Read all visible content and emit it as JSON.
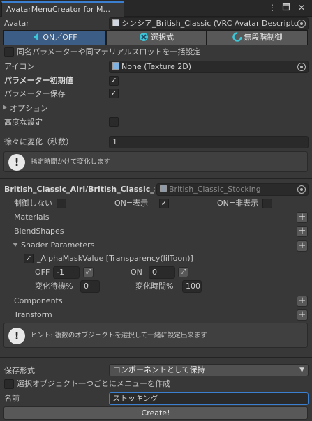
{
  "window": {
    "tab_title": "AvatarMenuCreator for M...",
    "menu_icon": "kebab-menu-icon",
    "maximize_icon": "maximize-icon",
    "close_icon": "close-icon"
  },
  "avatar": {
    "label": "Avatar",
    "value": "シンシア_British_Classic (VRC Avatar Descripto"
  },
  "mode_tabs": [
    {
      "label": "ON／OFF",
      "icon": "toggle-icon",
      "selected": true
    },
    {
      "label": "選択式",
      "icon": "select-icon",
      "selected": false
    },
    {
      "label": "無段階制御",
      "icon": "radial-icon",
      "selected": false
    }
  ],
  "options": {
    "same_param_label": "同名パラメーターや同マテリアルスロットを一括設定",
    "same_param_checked": false,
    "icon_label": "アイコン",
    "icon_value": "None (Texture 2D)",
    "param_default_label": "パラメーター初期値",
    "param_default_checked": true,
    "param_saved_label": "パラメーター保存",
    "param_saved_checked": true,
    "option_foldout_label": "オプション",
    "advanced_label": "高度な設定",
    "advanced_checked": false,
    "gradual_label": "徐々に変化（秒数）",
    "gradual_value": "1",
    "gradual_help": "指定時間かけて変化します"
  },
  "target": {
    "path": "British_Classic_Airi/British_Classic_S",
    "object": "British_Classic_Stocking",
    "no_control_label": "制御しない",
    "no_control_checked": false,
    "on_show_label": "ON=表示",
    "on_show_checked": true,
    "on_hide_label": "ON=非表示",
    "on_hide_checked": false,
    "materials_label": "Materials",
    "blendshapes_label": "BlendShapes",
    "shader_params_label": "Shader Parameters",
    "alpha_mask_label": "_AlphaMaskValue [Transparency(lilToon)]",
    "alpha_mask_checked": true,
    "off_label": "OFF",
    "off_value": "-1",
    "on_label": "ON",
    "on_value": "0",
    "wait_off_label": "変化待機%",
    "wait_off_value": "0",
    "duration_on_label": "変化時間%",
    "duration_on_value": "100",
    "components_label": "Components",
    "transform_label": "Transform",
    "add_label": "+",
    "swap_icon": "swap-icon",
    "hint_text": "ヒント: 複数のオブジェクトを選択して一緒に設定出来ます"
  },
  "footer": {
    "save_format_label": "保存形式",
    "save_format_value": "コンポーネントとして保持",
    "per_object_label": "選択オブジェクト一つごとにメニューを作成",
    "per_object_checked": false,
    "name_label": "名前",
    "name_value": "ストッキング",
    "create_label": "Create!"
  },
  "colors": {
    "background": "#383838",
    "selected_tab": "#3c5e86",
    "accent": "#3b7fd0",
    "text": "#c8c8c8"
  }
}
